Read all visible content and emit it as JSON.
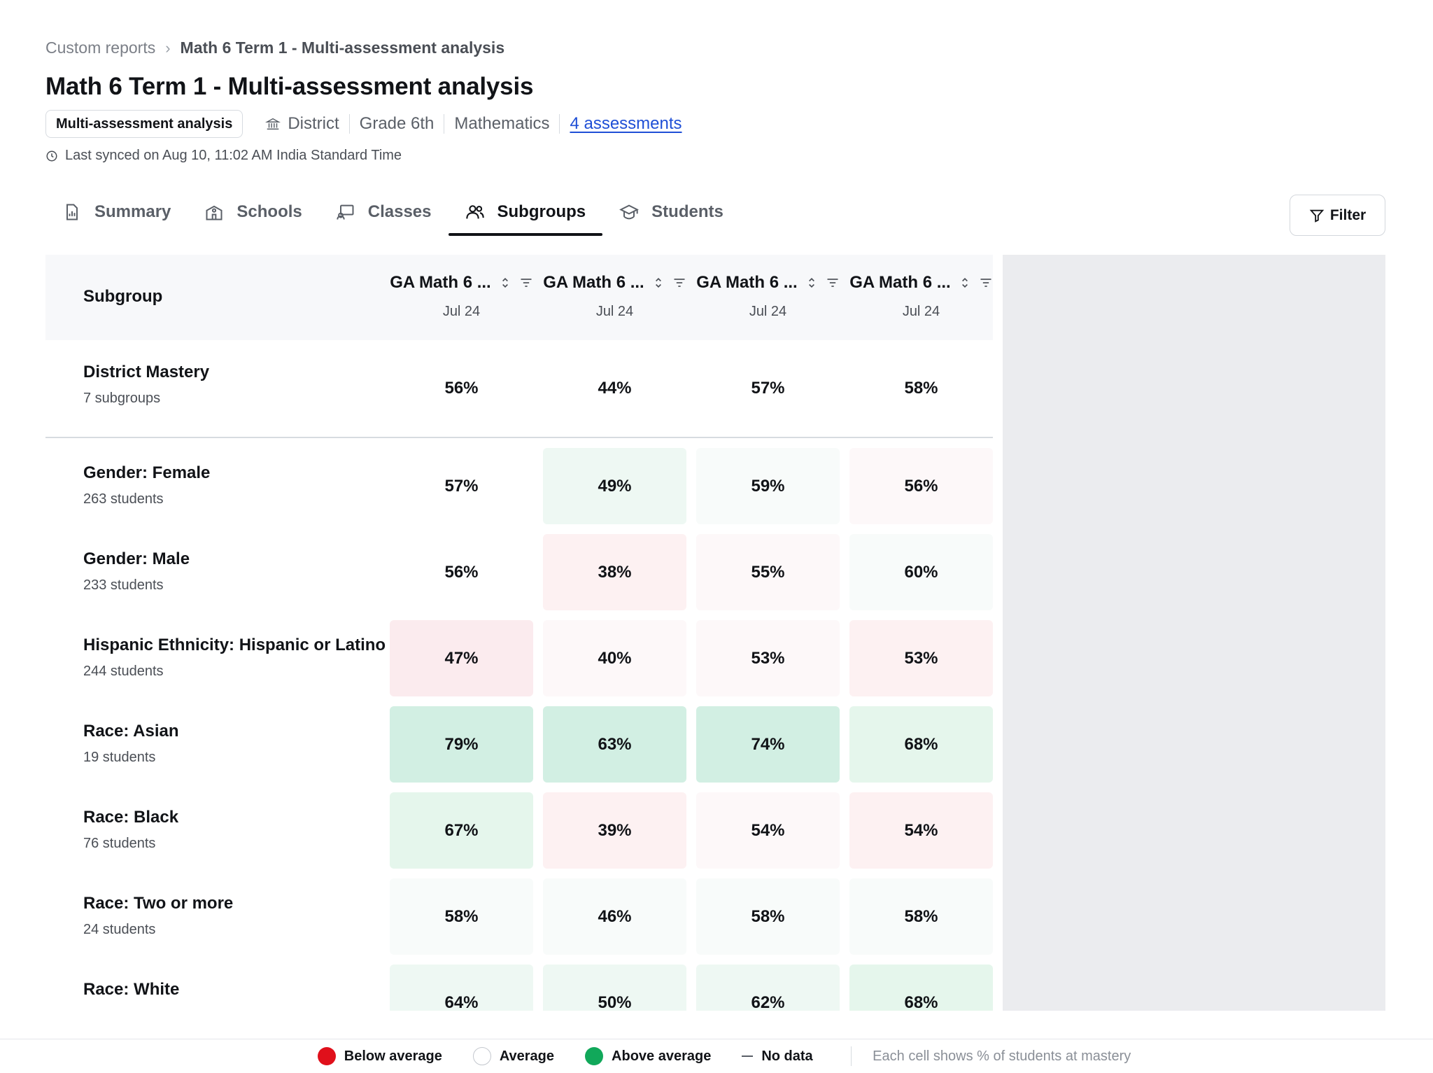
{
  "breadcrumb": {
    "root": "Custom reports",
    "separator": "›",
    "current": "Math 6 Term 1 - Multi-assessment analysis"
  },
  "page_title": "Math 6 Term 1 - Multi-assessment analysis",
  "meta": {
    "type_pill": "Multi-assessment analysis",
    "level": "District",
    "grade": "Grade 6th",
    "subject": "Mathematics",
    "assessments_link": "4 assessments"
  },
  "sync_text": "Last synced on Aug 10, 11:02 AM India Standard Time",
  "tabs": [
    {
      "label": "Summary",
      "icon": "report-icon",
      "active": false
    },
    {
      "label": "Schools",
      "icon": "school-icon",
      "active": false
    },
    {
      "label": "Classes",
      "icon": "classroom-icon",
      "active": false
    },
    {
      "label": "Subgroups",
      "icon": "people-icon",
      "active": true
    },
    {
      "label": "Students",
      "icon": "graduation-cap-icon",
      "active": false
    }
  ],
  "filter_label": "Filter",
  "table": {
    "subgroup_header": "Subgroup",
    "columns": [
      {
        "title": "GA Math 6 ...",
        "date": "Jul 24"
      },
      {
        "title": "GA Math 6 ...",
        "date": "Jul 24"
      },
      {
        "title": "GA Math 6 ...",
        "date": "Jul 24"
      },
      {
        "title": "GA Math 6 ...",
        "date": "Jul 24"
      }
    ],
    "summary_row": {
      "name": "District Mastery",
      "sub": "7 subgroups",
      "values": [
        "56%",
        "44%",
        "57%",
        "58%"
      ]
    },
    "rows": [
      {
        "name": "Gender: Female",
        "sub": "263 students",
        "values": [
          "57%",
          "49%",
          "59%",
          "56%"
        ],
        "tints": [
          "none",
          "green1",
          "green0",
          "red0"
        ]
      },
      {
        "name": "Gender: Male",
        "sub": "233 students",
        "values": [
          "56%",
          "38%",
          "55%",
          "60%"
        ],
        "tints": [
          "none",
          "red1",
          "red0",
          "green0"
        ]
      },
      {
        "name": "Hispanic Ethnicity: Hispanic or Latino",
        "sub": "244 students",
        "values": [
          "47%",
          "40%",
          "53%",
          "53%"
        ],
        "tints": [
          "red2",
          "red0",
          "red0",
          "red1"
        ]
      },
      {
        "name": "Race: Asian",
        "sub": "19 students",
        "values": [
          "79%",
          "63%",
          "74%",
          "68%"
        ],
        "tints": [
          "green3",
          "green3",
          "green3",
          "green2"
        ]
      },
      {
        "name": "Race: Black",
        "sub": "76 students",
        "values": [
          "67%",
          "39%",
          "54%",
          "54%"
        ],
        "tints": [
          "green2",
          "red1",
          "red0",
          "red1"
        ]
      },
      {
        "name": "Race: Two or more",
        "sub": "24 students",
        "values": [
          "58%",
          "46%",
          "58%",
          "58%"
        ],
        "tints": [
          "green0",
          "green0",
          "green0",
          "green0"
        ]
      },
      {
        "name": "Race: White",
        "sub": "",
        "values": [
          "64%",
          "50%",
          "62%",
          "68%"
        ],
        "tints": [
          "green1",
          "green1",
          "green1",
          "green2"
        ]
      }
    ]
  },
  "tint_colors": {
    "none": "#ffffff",
    "green0": "#f8fbfa",
    "green1": "#eef8f3",
    "green2": "#e5f6ec",
    "green3": "#d2efe3",
    "red0": "#fdf8f9",
    "red1": "#fdf1f2",
    "red2": "#fbebee"
  },
  "legend": {
    "below": "Below average",
    "average": "Average",
    "above": "Above average",
    "no_data": "No data",
    "note": "Each cell shows % of students at mastery"
  }
}
